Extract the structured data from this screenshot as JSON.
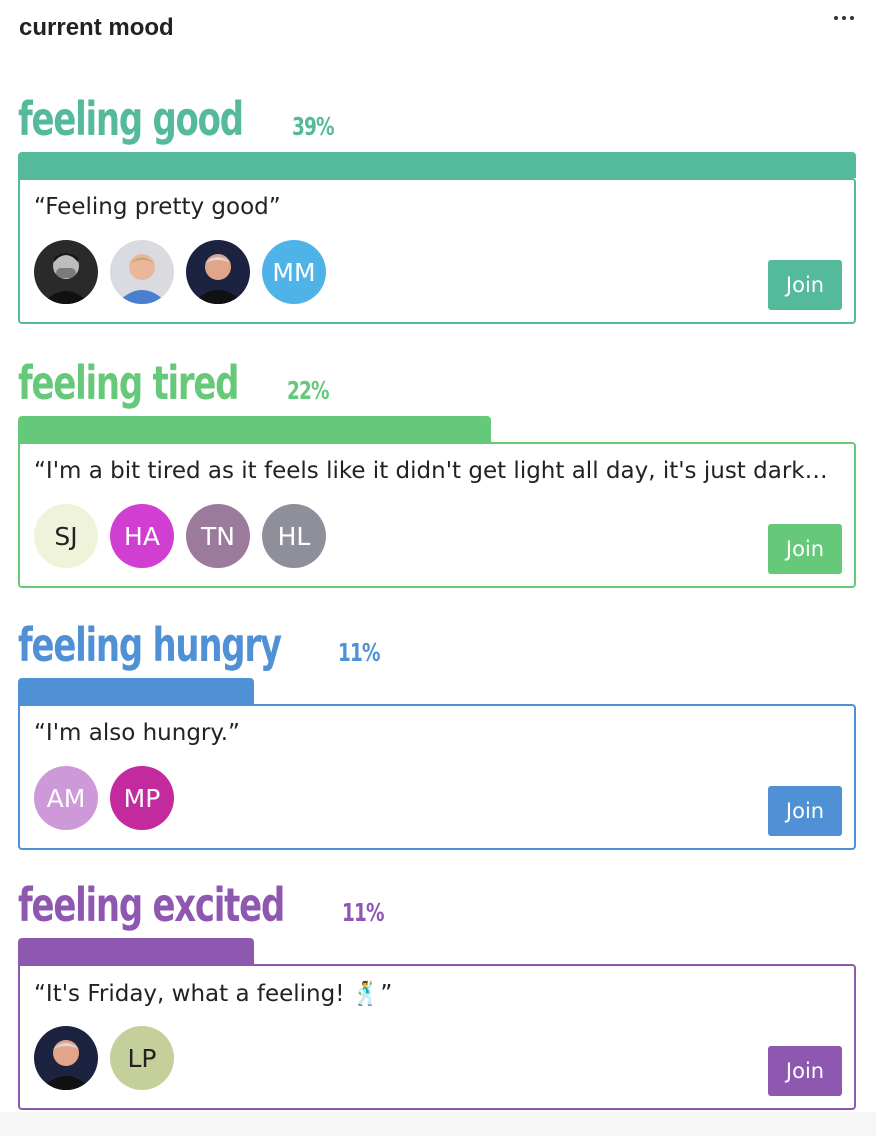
{
  "widget": {
    "title": "current mood"
  },
  "moods": [
    {
      "name": "feeling good",
      "percent": "39%",
      "fraction": 0.39,
      "color": "#55b99b",
      "quote": "“Feeling pretty good”",
      "avatars": [
        {
          "type": "photo",
          "icon": "person-photo-bw"
        },
        {
          "type": "photo",
          "icon": "person-photo-blue-shirt"
        },
        {
          "type": "photo",
          "icon": "person-photo-dark"
        },
        {
          "type": "initials",
          "initials": "MM",
          "bg": "#4fb3e8",
          "fg": "#ffffff"
        }
      ],
      "join_label": "Join"
    },
    {
      "name": "feeling tired",
      "percent": "22%",
      "fraction": 0.22,
      "color": "#66c97a",
      "quote": "“I'm a bit tired as it feels like it didn't get light all day, it's just dark a…",
      "avatars": [
        {
          "type": "initials",
          "initials": "SJ",
          "bg": "#eef3d9",
          "fg": "#222222"
        },
        {
          "type": "initials",
          "initials": "HA",
          "bg": "#d13ed2",
          "fg": "#ffffff"
        },
        {
          "type": "initials",
          "initials": "TN",
          "bg": "#9b7a9b",
          "fg": "#ffffff"
        },
        {
          "type": "initials",
          "initials": "HL",
          "bg": "#8f8f9c",
          "fg": "#ffffff"
        }
      ],
      "join_label": "Join"
    },
    {
      "name": "feeling hungry",
      "percent": "11%",
      "fraction": 0.11,
      "color": "#4f91d4",
      "quote": "“I'm also hungry.”",
      "avatars": [
        {
          "type": "initials",
          "initials": "AM",
          "bg": "#cd99d8",
          "fg": "#ffffff"
        },
        {
          "type": "initials",
          "initials": "MP",
          "bg": "#c22a9e",
          "fg": "#ffffff"
        }
      ],
      "join_label": "Join"
    },
    {
      "name": "feeling excited",
      "percent": "11%",
      "fraction": 0.11,
      "color": "#8f58b0",
      "quote": "“It's Friday, what a feeling! 🕺”",
      "avatars": [
        {
          "type": "photo",
          "icon": "person-photo-dark"
        },
        {
          "type": "initials",
          "initials": "LP",
          "bg": "#c4cf9a",
          "fg": "#222222"
        }
      ],
      "join_label": "Join"
    }
  ]
}
